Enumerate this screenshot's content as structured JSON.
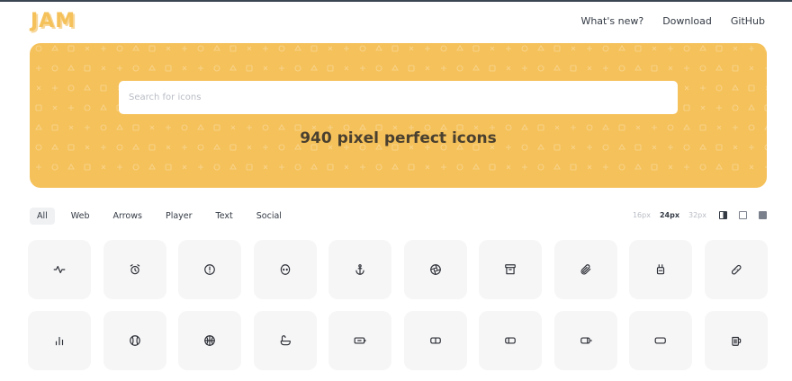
{
  "header": {
    "logo": "JAM",
    "nav": [
      {
        "label": "What's new?"
      },
      {
        "label": "Download"
      },
      {
        "label": "GitHub"
      }
    ]
  },
  "hero": {
    "search_placeholder": "Search for icons",
    "search_value": "",
    "title": "940 pixel perfect icons",
    "accent_color": "#f5c15a"
  },
  "filters": {
    "categories": [
      "All",
      "Web",
      "Arrows",
      "Player",
      "Text",
      "Social"
    ],
    "active": "All",
    "sizes": [
      "16px",
      "24px",
      "32px"
    ],
    "active_size": "24px",
    "themes": [
      "half-fill-icon",
      "outline-square-icon",
      "filled-square-icon"
    ]
  },
  "icons": [
    [
      "activity-icon",
      "alarm-clock-icon",
      "alert-circle-icon",
      "alien-icon",
      "anchor-icon",
      "aperture-icon",
      "archive-icon",
      "paperclip-icon",
      "battery-plug-icon",
      "bandage-icon"
    ],
    [
      "bar-chart-icon",
      "baseball-icon",
      "basketball-icon",
      "bathtub-icon",
      "battery-charging-icon",
      "battery-half-icon",
      "battery-quarter-icon",
      "battery-three-quarter-icon",
      "battery-empty-icon",
      "beer-icon"
    ]
  ]
}
